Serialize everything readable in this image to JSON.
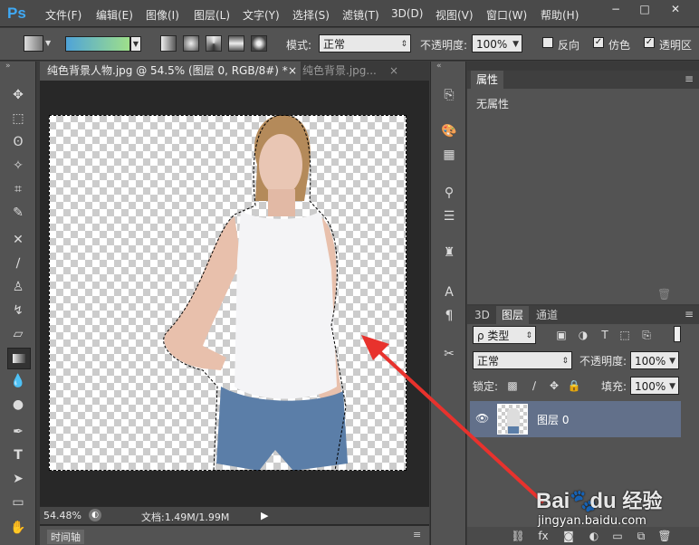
{
  "app": {
    "logo": "Ps"
  },
  "menu": [
    "文件(F)",
    "编辑(E)",
    "图像(I)",
    "图层(L)",
    "文字(Y)",
    "选择(S)",
    "滤镜(T)",
    "3D(D)",
    "视图(V)",
    "窗口(W)",
    "帮助(H)"
  ],
  "window_controls": {
    "minimize": "−",
    "maximize": "□",
    "close": "✕"
  },
  "options": {
    "mode_label": "模式:",
    "mode_value": "正常",
    "opacity_label": "不透明度:",
    "opacity_value": "100%",
    "reverse_label": "反向",
    "dither_label": "仿色",
    "transparency_label": "透明区",
    "dither_checked": "✓",
    "transparency_checked": "✓",
    "gradient_colors": [
      "#4fa3d8",
      "#9fe08a"
    ]
  },
  "tabs": [
    {
      "label": "纯色背景人物.jpg @ 54.5% (图层 0, RGB/8#) *",
      "close": "×"
    },
    {
      "label": "纯色背景.jpg...",
      "close": "×"
    }
  ],
  "status": {
    "zoom": "54.48%",
    "doc": "文档:1.49M/1.99M"
  },
  "timeline": {
    "label": "时间轴"
  },
  "properties": {
    "tab": "属性",
    "content": "无属性"
  },
  "layers_panel": {
    "tabs": [
      "3D",
      "图层",
      "通道"
    ],
    "filter_label": "ρ 类型",
    "blend_mode": "正常",
    "opacity_label": "不透明度:",
    "opacity_value": "100%",
    "lock_label": "锁定:",
    "fill_label": "填充:",
    "fill_value": "100%",
    "layer_name": "图层 0"
  },
  "watermark": {
    "brand": "Bai",
    "du": "du",
    "jingyan": "经验",
    "url": "jingyan.baidu.com"
  },
  "colors": {
    "arrow": "#e8322d",
    "selected_layer": "#62708a"
  }
}
